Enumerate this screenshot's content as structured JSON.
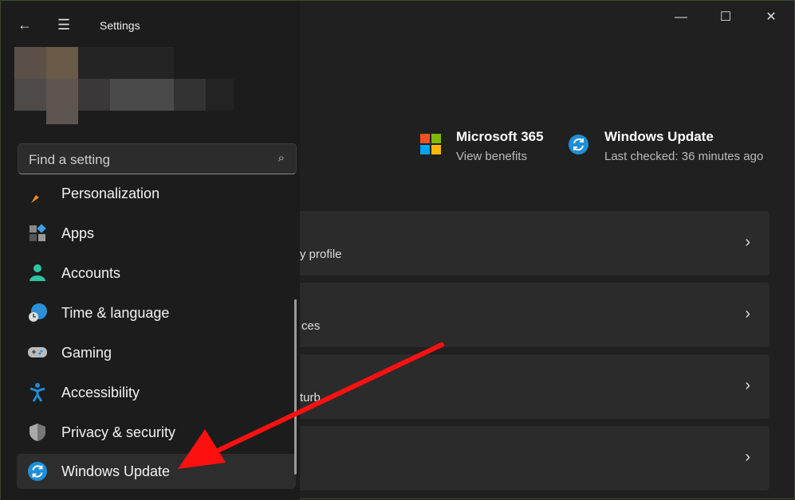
{
  "titlebar": {
    "title": "Settings",
    "back_icon": "←",
    "menu_icon": "☰",
    "minimize": "—",
    "maximize": "☐",
    "close": "✕"
  },
  "search": {
    "placeholder": "Find a setting",
    "icon": "⌕"
  },
  "nav": [
    {
      "label": "Personalization",
      "icon": "brush-icon"
    },
    {
      "label": "Apps",
      "icon": "apps-icon"
    },
    {
      "label": "Accounts",
      "icon": "person-icon"
    },
    {
      "label": "Time & language",
      "icon": "globe-clock-icon"
    },
    {
      "label": "Gaming",
      "icon": "gamepad-icon"
    },
    {
      "label": "Accessibility",
      "icon": "accessibility-icon"
    },
    {
      "label": "Privacy & security",
      "icon": "shield-icon"
    },
    {
      "label": "Windows Update",
      "icon": "sync-icon",
      "selected": true
    }
  ],
  "header": {
    "ms365": {
      "title": "Microsoft 365",
      "subtitle": "View benefits"
    },
    "update": {
      "title": "Windows Update",
      "subtitle": "Last checked: 36 minutes ago"
    }
  },
  "cards": [
    {
      "subtitle": "y profile",
      "chevron": "›"
    },
    {
      "subtitle": "ces",
      "chevron": "›"
    },
    {
      "subtitle": "turb",
      "chevron": "›"
    },
    {
      "subtitle": "",
      "chevron": "›"
    }
  ],
  "colors": {
    "accent": "#1e8fd8",
    "annotation": "#ff1010"
  }
}
